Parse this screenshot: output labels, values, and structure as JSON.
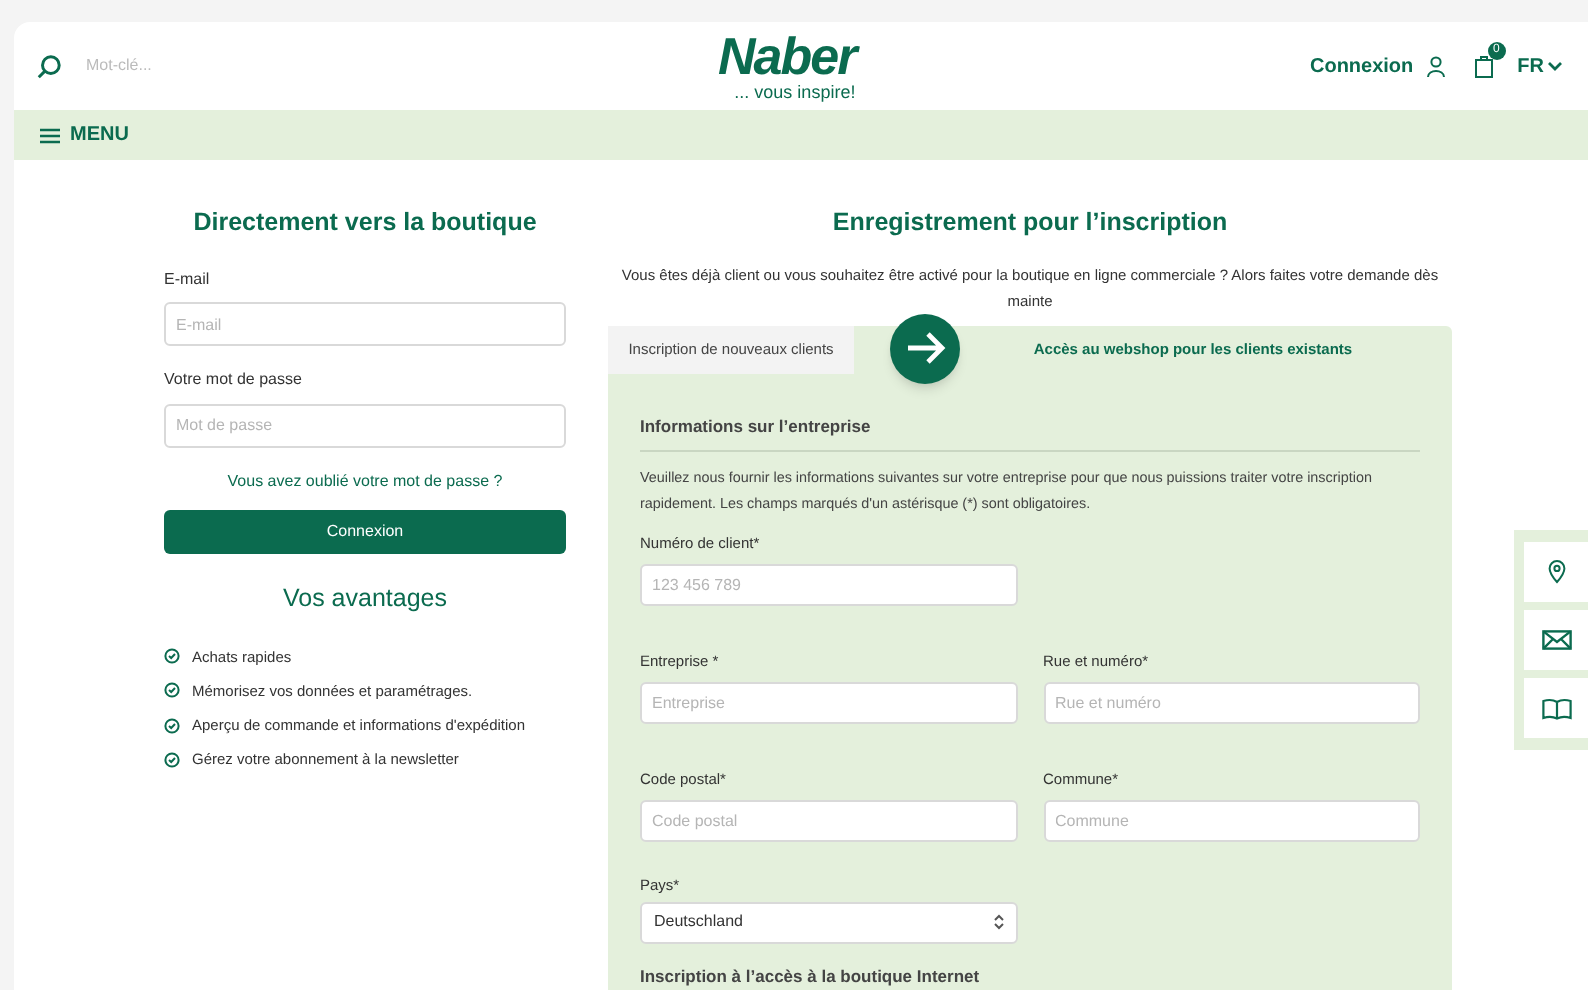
{
  "header": {
    "search": {
      "placeholder": "Mot-clé..."
    },
    "logo": {
      "name": "Naber",
      "tagline": "... vous inspire!"
    },
    "login_link": "Connexion",
    "cart_count": "0",
    "language": "FR"
  },
  "menu": {
    "label": "MENU"
  },
  "login": {
    "title": "Directement vers la boutique",
    "fields": [
      {
        "label": "E-mail",
        "placeholder": "E-mail"
      },
      {
        "label": "Votre mot de passe",
        "placeholder": "Mot de passe"
      }
    ],
    "forgot_link": "Vous avez oublié votre mot de passe ?",
    "button": "Connexion"
  },
  "advantages": {
    "title": "Vos avantages",
    "items": [
      "Achats rapides",
      "Mémorisez vos données et paramétrages.",
      "Aperçu de commande et informations d'expédition",
      "Gérez votre abonnement à la newsletter"
    ]
  },
  "registration": {
    "title": "Enregistrement pour l’inscription",
    "intro": "Vous êtes déjà client ou vous souhaitez être activé pour la boutique en ligne commerciale ? Alors faites votre demande dès mainte",
    "tabs": [
      {
        "label": "Inscription de nouveaux clients",
        "selected": false
      },
      {
        "label": "Accès au webshop pour les clients existants",
        "selected": true
      }
    ],
    "section_title": "Informations sur l’entreprise",
    "section_text": "Veuillez nous fournir les informations suivantes sur votre entreprise pour que nous puissions traiter votre inscription rapidement. Les champs marqués d'un astérisque (*) sont obligatoires.",
    "rows": [
      [
        {
          "label": "Numéro de client*",
          "placeholder": "123 456 789",
          "kind": "input"
        }
      ],
      [
        {
          "label": "Entreprise *",
          "placeholder": "Entreprise",
          "kind": "input"
        },
        {
          "label": "Rue et numéro*",
          "placeholder": "Rue et numéro",
          "kind": "input"
        }
      ],
      [
        {
          "label": "Code postal*",
          "placeholder": "Code postal",
          "kind": "input"
        },
        {
          "label": "Commune*",
          "placeholder": "Commune",
          "kind": "input"
        }
      ],
      [
        {
          "label": "Pays*",
          "value": "Deutschland",
          "kind": "select"
        }
      ]
    ],
    "next_section_title": "Inscription à l’accès à la boutique Internet"
  }
}
